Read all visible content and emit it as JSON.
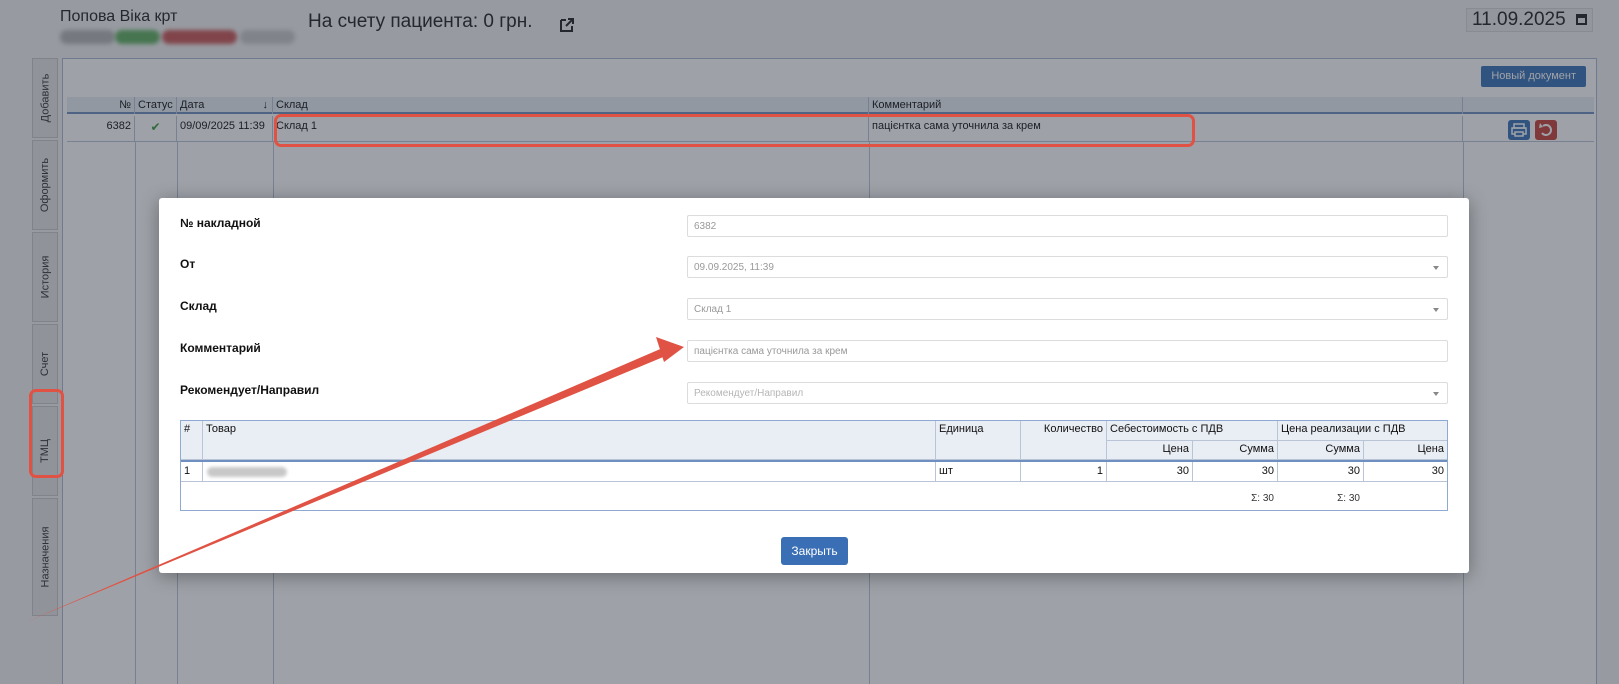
{
  "header": {
    "patient_name": "Попова Віка крт",
    "account_text": "На счету пациента: 0 грн.",
    "date": "11.09.2025"
  },
  "side_tabs": [
    "Добавить",
    "Оформить",
    "История",
    "Счет",
    "ТМЦ",
    "Назначения"
  ],
  "toolbar": {
    "new_document": "Новый документ"
  },
  "grid": {
    "columns": [
      "№",
      "Статус",
      "Дата",
      "Склад",
      "Комментарий"
    ],
    "rows": [
      {
        "number": "6382",
        "status_icon": "check-icon",
        "date": "09/09/2025 11:39",
        "warehouse": "Склад 1",
        "comment": "пацієнтка сама уточнила за крем"
      }
    ]
  },
  "modal": {
    "labels": {
      "invoice": "№ накладной",
      "from": "От",
      "warehouse": "Склад",
      "comment": "Комментарий",
      "recommended": "Рекомендует/Направил"
    },
    "values": {
      "invoice": "6382",
      "from": "09.09.2025, 11:39",
      "warehouse": "Склад 1",
      "comment": "пацієнтка сама уточнила за крем",
      "recommended_placeholder": "Рекомендует/Направил"
    },
    "items": {
      "headers": {
        "num": "#",
        "product": "Товар",
        "unit": "Единица",
        "qty": "Количество",
        "cost_group": "Себестоимость с ПДВ",
        "sale_group": "Цена реализации с ПДВ",
        "cost_price": "Цена",
        "cost_sum": "Сумма",
        "sale_sum": "Сумма",
        "sale_price": "Цена"
      },
      "rows": [
        {
          "num": "1",
          "unit": "шт",
          "qty": "1",
          "cost_price": "30",
          "cost_sum": "30",
          "sale_sum": "30",
          "sale_price": "30"
        }
      ],
      "totals": {
        "cost_sum": "Σ: 30",
        "sale_sum": "Σ: 30"
      }
    },
    "close": "Закрыть"
  },
  "colors": {
    "accent": "#3a6fb5",
    "highlight": "#e05243",
    "danger": "#c9413a",
    "success": "#3c9a3c"
  }
}
